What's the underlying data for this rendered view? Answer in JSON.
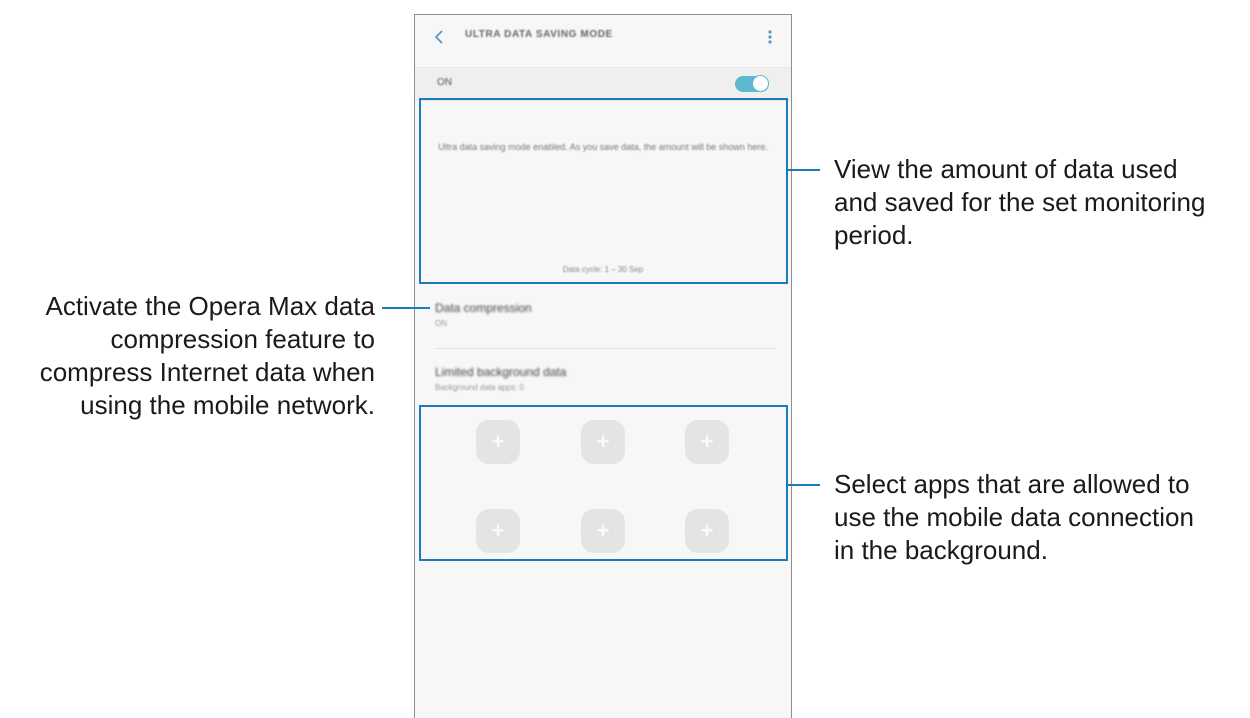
{
  "screen": {
    "title": "ULTRA DATA SAVING MODE",
    "toggle_label": "ON",
    "usage_message": "Ultra data saving mode enabled. As you save data, the amount will be shown here.",
    "data_cycle": "Data cycle: 1 – 30 Sep",
    "data_compression": {
      "title": "Data compression",
      "value": "ON"
    },
    "limited_background": {
      "title": "Limited background data",
      "value": "Background data apps: 0"
    },
    "add_app_symbol": "+"
  },
  "annotations": {
    "usage_view": [
      "View the amount of data used",
      "and saved for the set monitoring",
      "period."
    ],
    "compression": [
      "Activate the Opera Max data",
      "compression feature to",
      "compress Internet data when",
      "using the mobile network."
    ],
    "apps": [
      "Select apps that are allowed to",
      "use the mobile data connection",
      "in the background."
    ]
  },
  "colors": {
    "highlight": "#1b7bbd",
    "toggle_on": "#5bb8d0"
  },
  "icons": {
    "back": "chevron-left-icon",
    "more": "more-vertical-icon"
  }
}
